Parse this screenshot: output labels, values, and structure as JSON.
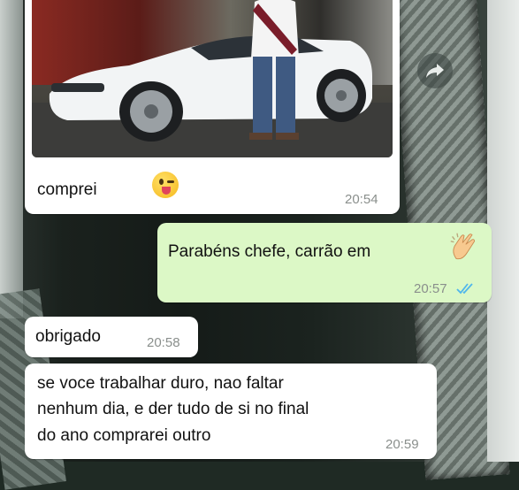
{
  "messages": [
    {
      "direction": "incoming",
      "type": "image",
      "caption": "comprei",
      "emoji": "winking-face-with-tongue",
      "time": "20:54"
    },
    {
      "direction": "outgoing",
      "type": "text",
      "text": "Parabéns chefe, carrão em",
      "emoji": "clapping-hands",
      "time": "20:57",
      "status": "read"
    },
    {
      "direction": "incoming",
      "type": "text",
      "text": "obrigado",
      "time": "20:58"
    },
    {
      "direction": "incoming",
      "type": "text",
      "lines": [
        "se voce trabalhar duro, nao faltar",
        "nenhum dia, e der tudo de si no final",
        "do ano comprarei outro"
      ],
      "time": "20:59"
    }
  ],
  "colors": {
    "incoming_bubble": "#ffffff",
    "outgoing_bubble": "#dcf8c6",
    "read_check": "#4fb6ec",
    "timestamp": "#8a8f8c"
  },
  "icons": {
    "forward": "forward-arrow-icon",
    "status": "double-check-icon"
  }
}
